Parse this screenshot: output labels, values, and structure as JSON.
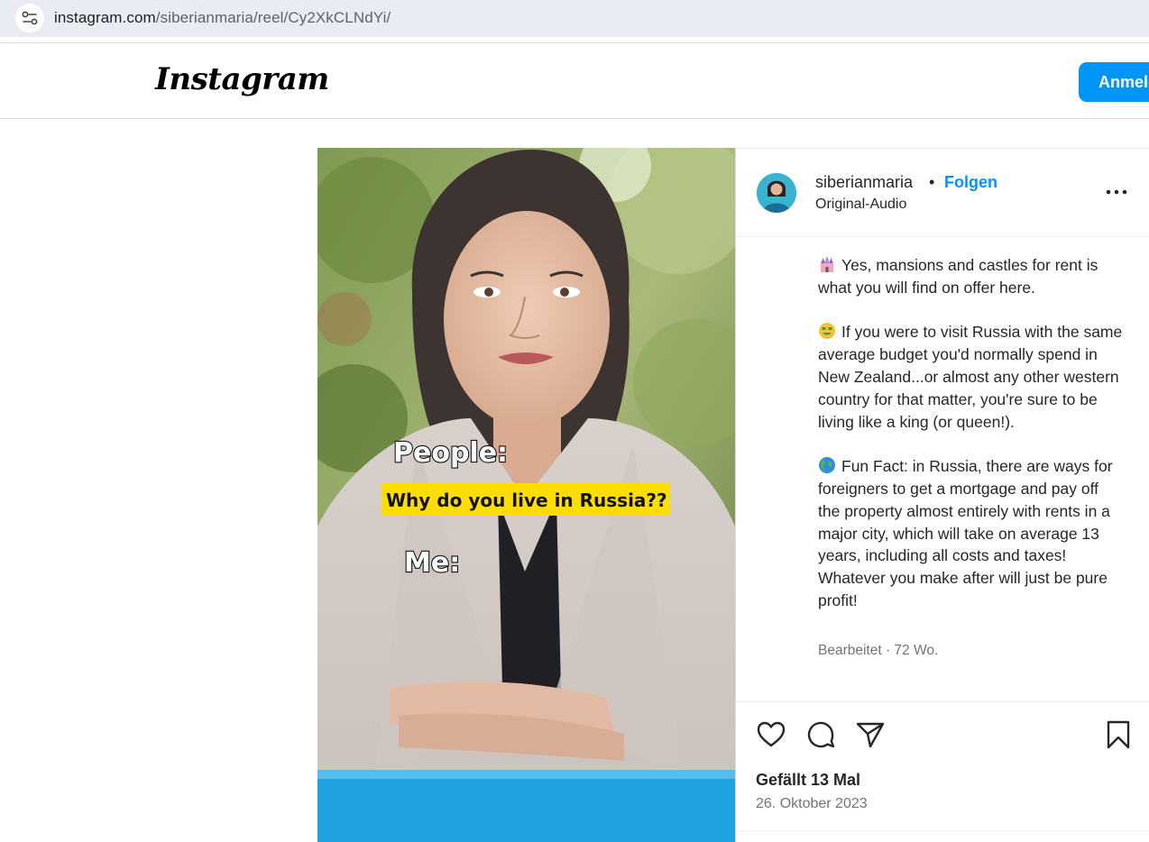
{
  "browser": {
    "url_host": "instagram.com",
    "url_path": "/siberianmaria/reel/Cy2XkCLNdYi/"
  },
  "header": {
    "logo_text": "Instagram",
    "login_label": "Anmelden"
  },
  "media": {
    "overlay_people": "People:",
    "overlay_question": "Why do you live in Russia??",
    "overlay_me": "Me:"
  },
  "post": {
    "username": "siberianmaria",
    "separator": "•",
    "follow_label": "Folgen",
    "audio": "Original-Audio",
    "caption_paragraphs": [
      {
        "icon": "castle-emoji",
        "text": "Yes, mansions and castles for rent is what you will find on offer here."
      },
      {
        "icon": "money-mouth-face-emoji",
        "text": "If you were to visit Russia with the same average budget you'd normally spend in New Zealand...or almost any other western country for that matter, you're sure to be living like a king (or queen!)."
      },
      {
        "icon": "globe-emoji",
        "text": "Fun Fact: in Russia, there are ways for foreigners to get a mortgage and pay off the property almost entirely with rents in a major city, which will take on average 13 years, including all costs and taxes! Whatever you make after will just be pure profit!"
      }
    ],
    "meta": "Bearbeitet · 72 Wo.",
    "likes": "Gefällt 13 Mal",
    "date": "26. Oktober 2023"
  },
  "colors": {
    "accent": "#0095f6",
    "urlbar_bg": "#e9edf3",
    "border": "#dbdbdb",
    "overlay_highlight": "#ffdd00"
  }
}
